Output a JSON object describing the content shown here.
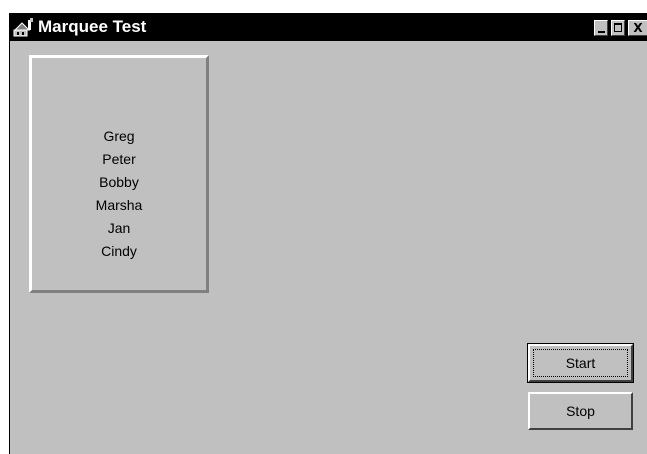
{
  "window": {
    "title": "Marquee Test"
  },
  "titlebar_buttons": {
    "minimize": "",
    "maximize": "",
    "close": "X"
  },
  "marquee": {
    "names": [
      "Greg",
      "Peter",
      "Bobby",
      "Marsha",
      "Jan",
      "Cindy"
    ]
  },
  "buttons": {
    "start_label": "Start",
    "stop_label": "Stop"
  },
  "colors": {
    "titlebar": "#000000",
    "face": "#c0c0c0"
  },
  "icons": {
    "app": "app-icon"
  }
}
